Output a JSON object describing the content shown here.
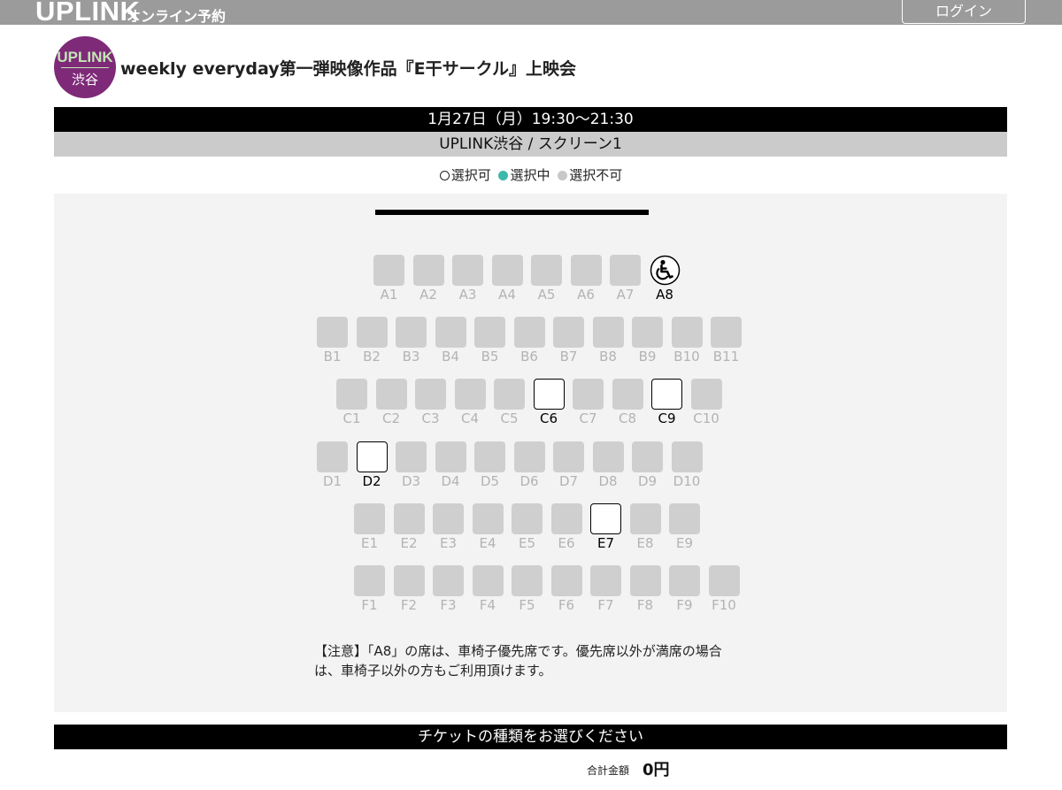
{
  "header": {
    "brand": "UPLINK",
    "brand_sub": "オンライン予約",
    "login_label": "ログイン"
  },
  "logo": {
    "top": "UPLINK",
    "bottom": "渋谷"
  },
  "event": {
    "title": "weekly everyday第一弾映像作品『E干サークル』上映会",
    "datetime": "1月27日（月）19:30〜21:30",
    "venue": "UPLINK渋谷 / スクリーン1"
  },
  "legend": {
    "available": "選択可",
    "selected": "選択中",
    "unavailable": "選択不可"
  },
  "seat_rows": [
    {
      "row": "A",
      "seats": [
        {
          "label": "A1",
          "status": "unavailable"
        },
        {
          "label": "A2",
          "status": "unavailable"
        },
        {
          "label": "A3",
          "status": "unavailable"
        },
        {
          "label": "A4",
          "status": "unavailable"
        },
        {
          "label": "A5",
          "status": "unavailable"
        },
        {
          "label": "A6",
          "status": "unavailable"
        },
        {
          "label": "A7",
          "status": "unavailable"
        },
        {
          "label": "A8",
          "status": "wheelchair"
        }
      ]
    },
    {
      "row": "B",
      "seats": [
        {
          "label": "B1",
          "status": "unavailable"
        },
        {
          "label": "B2",
          "status": "unavailable"
        },
        {
          "label": "B3",
          "status": "unavailable"
        },
        {
          "label": "B4",
          "status": "unavailable"
        },
        {
          "label": "B5",
          "status": "unavailable"
        },
        {
          "label": "B6",
          "status": "unavailable"
        },
        {
          "label": "B7",
          "status": "unavailable"
        },
        {
          "label": "B8",
          "status": "unavailable"
        },
        {
          "label": "B9",
          "status": "unavailable"
        },
        {
          "label": "B10",
          "status": "unavailable"
        },
        {
          "label": "B11",
          "status": "unavailable"
        }
      ]
    },
    {
      "row": "C",
      "seats": [
        {
          "label": "C1",
          "status": "unavailable"
        },
        {
          "label": "C2",
          "status": "unavailable"
        },
        {
          "label": "C3",
          "status": "unavailable"
        },
        {
          "label": "C4",
          "status": "unavailable"
        },
        {
          "label": "C5",
          "status": "unavailable"
        },
        {
          "label": "C6",
          "status": "available"
        },
        {
          "label": "C7",
          "status": "unavailable"
        },
        {
          "label": "C8",
          "status": "unavailable"
        },
        {
          "label": "C9",
          "status": "available"
        },
        {
          "label": "C10",
          "status": "unavailable"
        }
      ]
    },
    {
      "row": "D",
      "seats": [
        {
          "label": "D1",
          "status": "unavailable"
        },
        {
          "label": "D2",
          "status": "available"
        },
        {
          "label": "D3",
          "status": "unavailable"
        },
        {
          "label": "D4",
          "status": "unavailable"
        },
        {
          "label": "D5",
          "status": "unavailable"
        },
        {
          "label": "D6",
          "status": "unavailable"
        },
        {
          "label": "D7",
          "status": "unavailable"
        },
        {
          "label": "D8",
          "status": "unavailable"
        },
        {
          "label": "D9",
          "status": "unavailable"
        },
        {
          "label": "D10",
          "status": "unavailable"
        }
      ]
    },
    {
      "row": "E",
      "seats": [
        {
          "label": "E1",
          "status": "unavailable"
        },
        {
          "label": "E2",
          "status": "unavailable"
        },
        {
          "label": "E3",
          "status": "unavailable"
        },
        {
          "label": "E4",
          "status": "unavailable"
        },
        {
          "label": "E5",
          "status": "unavailable"
        },
        {
          "label": "E6",
          "status": "unavailable"
        },
        {
          "label": "E7",
          "status": "available"
        },
        {
          "label": "E8",
          "status": "unavailable"
        },
        {
          "label": "E9",
          "status": "unavailable"
        }
      ]
    },
    {
      "row": "F",
      "seats": [
        {
          "label": "F1",
          "status": "unavailable"
        },
        {
          "label": "F2",
          "status": "unavailable"
        },
        {
          "label": "F3",
          "status": "unavailable"
        },
        {
          "label": "F4",
          "status": "unavailable"
        },
        {
          "label": "F5",
          "status": "unavailable"
        },
        {
          "label": "F6",
          "status": "unavailable"
        },
        {
          "label": "F7",
          "status": "unavailable"
        },
        {
          "label": "F8",
          "status": "unavailable"
        },
        {
          "label": "F9",
          "status": "unavailable"
        },
        {
          "label": "F10",
          "status": "unavailable"
        }
      ]
    }
  ],
  "note": "【注意】「A8」の席は、車椅子優先席です。優先席以外が満席の場合は、車椅子以外の方もご利用頂けます。",
  "ticket_section_title": "チケットの種類をお選びください",
  "total": {
    "label": "合計金額",
    "value": "0円"
  },
  "icons": {
    "wheelchair": "wheelchair-icon"
  },
  "colors": {
    "selected": "#3fb8ac",
    "logo_bg": "#7e2a78",
    "header_bg": "#9b9b9b"
  }
}
